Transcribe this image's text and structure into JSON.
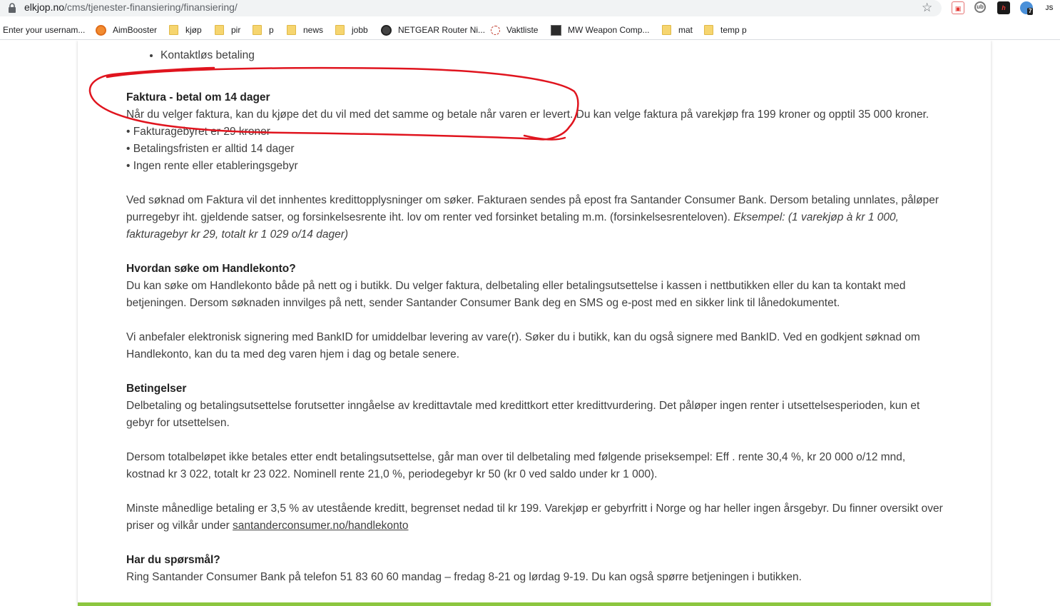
{
  "browser": {
    "url_domain": "elkjop.no",
    "url_path": "/cms/tjenester-finansiering/finansiering/",
    "bookmarks": [
      {
        "label": "Enter your usernam..."
      },
      {
        "label": "AimBooster"
      },
      {
        "label": "kjøp"
      },
      {
        "label": "pir"
      },
      {
        "label": "p"
      },
      {
        "label": "news"
      },
      {
        "label": "jobb"
      },
      {
        "label": "NETGEAR Router Ni..."
      },
      {
        "label": "Vaktliste"
      },
      {
        "label": "MW Weapon Comp..."
      },
      {
        "label": "mat"
      },
      {
        "label": "temp p"
      }
    ],
    "extension_badge": "7",
    "extension_js": "JS"
  },
  "article": {
    "bullet_top": "Kontaktløs betaling",
    "faktura": {
      "heading": "Faktura - betal om 14 dager",
      "intro": "Når du velger faktura, kan du kjøpe det du vil med det samme og betale når varen er levert. Du kan velge faktura på varekjøp fra 199 kroner og opptil 35 000 kroner.",
      "line1": "• Fakturagebyret er 29 kroner",
      "line2": "• Betalingsfristen er alltid 14 dager",
      "line3": "• Ingen rente eller etableringsgebyr"
    },
    "soknad": {
      "text": "Ved søknad om Faktura vil det innhentes kredittopplysninger om søker. Fakturaen sendes på epost fra Santander Consumer Bank. Dersom betaling unnlates, påløper purregebyr iht. gjeldende satser, og forsinkelsesrente iht. lov om renter ved forsinket betaling m.m. (forsinkelsesrenteloven). ",
      "example": "Eksempel: (1 varekjøp à kr 1 000, fakturagebyr kr 29, totalt kr 1 029 o/14 dager)"
    },
    "handlekonto": {
      "heading": "Hvordan søke om Handlekonto?",
      "p1": "Du kan søke om Handlekonto både på nett og i butikk. Du velger faktura, delbetaling eller betalingsutsettelse i kassen i nettbutikken eller du kan ta kontakt med betjeningen. Dersom søknaden innvilges på nett, sender Santander Consumer Bank deg en SMS og e-post med en sikker link til lånedokumentet.",
      "p2": "Vi anbefaler elektronisk signering med BankID for umiddelbar levering av vare(r). Søker du i butikk, kan du også signere med BankID. Ved en godkjent søknad om Handlekonto, kan du ta med deg varen hjem i dag og betale senere."
    },
    "betingelser": {
      "heading": "Betingelser",
      "p1": "Delbetaling og betalingsutsettelse forutsetter inngåelse av kredittavtale med kredittkort etter kredittvurdering. Det påløper ingen renter i utsettelsesperioden, kun et gebyr for utsettelsen.",
      "p2": "Dersom totalbeløpet ikke betales etter endt betalingsutsettelse, går man over til delbetaling med følgende priseksempel: Eff . rente 30,4 %, kr 20 000 o/12 mnd, kostnad kr 3 022, totalt kr 23 022. Nominell rente 21,0 %, periodegebyr kr 50 (kr 0 ved saldo under kr 1 000).",
      "p3": "Minste månedlige betaling er 3,5 % av utestående kreditt, begrenset nedad til kr 199. Varekjøp er gebyrfritt i Norge og har heller ingen årsgebyr. Du finner oversikt over priser og vilkår under ",
      "link": "santanderconsumer.no/handlekonto"
    },
    "sporsmal": {
      "heading": "Har du spørsmål?",
      "text": "Ring Santander Consumer Bank på telefon 51 83 60 60 mandag – fredag 8-21 og lørdag 9-19. Du kan også spørre betjeningen i butikken."
    }
  },
  "colors": {
    "accent_green": "#8cc63f",
    "annotation_red": "#e0141e",
    "text": "#3f3f3f"
  },
  "icons": {
    "lock": "lock-icon",
    "star": "star-icon",
    "folder": "folder-icon"
  }
}
